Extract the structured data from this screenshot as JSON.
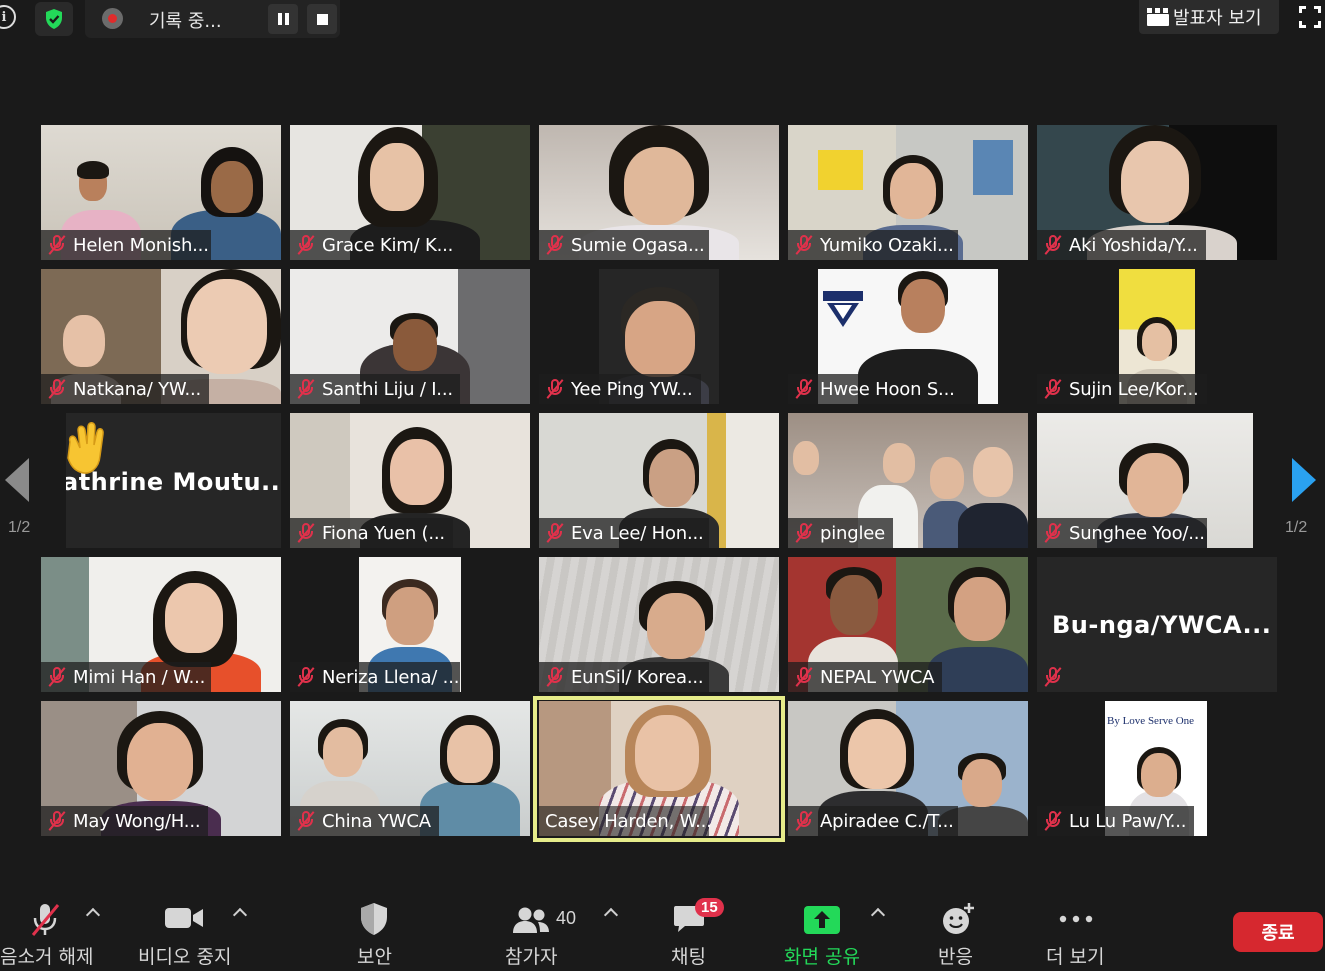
{
  "top_bar": {
    "recording_label": "기록 중...",
    "view_label": "발표자 보기"
  },
  "pagination": {
    "left": "1/2",
    "right": "1/2"
  },
  "participants": [
    {
      "name": "Helen Monish...",
      "muted": true
    },
    {
      "name": "Grace Kim/ K...",
      "muted": true
    },
    {
      "name": "Sumie Ogasa...",
      "muted": true
    },
    {
      "name": "Yumiko Ozaki...",
      "muted": true
    },
    {
      "name": "Aki Yoshida/Y...",
      "muted": true
    },
    {
      "name": "Natkana/ YW...",
      "muted": true
    },
    {
      "name": "Santhi Liju / I...",
      "muted": true
    },
    {
      "name": "Yee Ping YW...",
      "muted": true
    },
    {
      "name": "Hwee Hoon S...",
      "muted": true
    },
    {
      "name": "Sujin Lee/Kor...",
      "muted": true
    },
    {
      "name": "athrine  Moutu...",
      "muted": false,
      "video_off": true,
      "raised_hand": true
    },
    {
      "name": "Fiona Yuen (...",
      "muted": true
    },
    {
      "name": "Eva Lee/ Hon...",
      "muted": true
    },
    {
      "name": "pinglee",
      "muted": true
    },
    {
      "name": "Sunghee Yoo/...",
      "muted": true
    },
    {
      "name": "Mimi Han / W...",
      "muted": true
    },
    {
      "name": "Neriza Llena/ ...",
      "muted": true
    },
    {
      "name": "EunSil/ Korea...",
      "muted": true
    },
    {
      "name": "NEPAL YWCA",
      "muted": true
    },
    {
      "name": "Bu-nga/YWCA...",
      "muted": true,
      "video_off": true
    },
    {
      "name": "May Wong/H...",
      "muted": true
    },
    {
      "name": "China YWCA",
      "muted": true
    },
    {
      "name": "Casey Harden, W...",
      "muted": false,
      "active_speaker": true
    },
    {
      "name": "Apiradee C./T...",
      "muted": true
    },
    {
      "name": "Lu Lu Paw/Y...",
      "muted": true,
      "background_text": "By Love Serve One"
    }
  ],
  "toolbar": {
    "unmute_label": "음소거 해제",
    "stop_video_label": "비디오 중지",
    "security_label": "보안",
    "participants_label": "참가자",
    "participants_count": "40",
    "chat_label": "채팅",
    "chat_badge": "15",
    "share_label": "화면 공유",
    "reactions_label": "반응",
    "more_label": "더 보기",
    "end_label": "종료"
  },
  "colors": {
    "background": "#1a1a1a",
    "share_green": "#23d959",
    "end_red": "#d6282f",
    "muted_red": "#e0314b",
    "active_speaker_border": "#e6ec8a",
    "next_arrow_blue": "#2aa1f0"
  }
}
